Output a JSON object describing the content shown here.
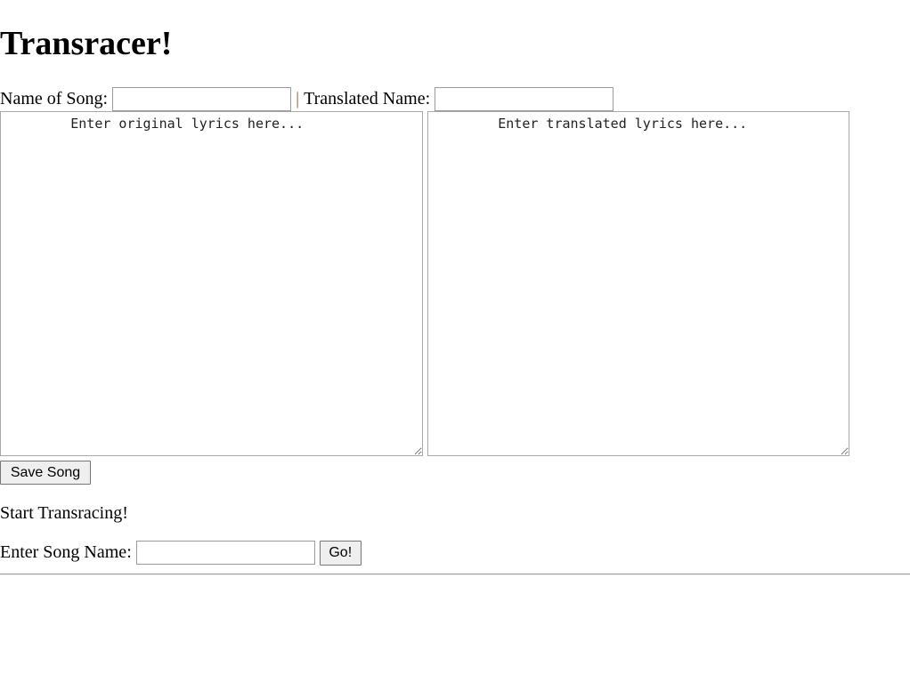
{
  "page": {
    "title": "Transracer!"
  },
  "song_form": {
    "name_label": "Name of Song:",
    "separator": "|",
    "translated_label": "Translated Name:",
    "name_value": "",
    "translated_value": "",
    "original_placeholder": "        Enter original lyrics here...",
    "translated_placeholder": "        Enter translated lyrics here...",
    "save_label": "Save Song"
  },
  "race": {
    "heading": "Start Transracing!",
    "song_label": "Enter Song Name:",
    "song_value": "",
    "go_label": "Go!"
  }
}
